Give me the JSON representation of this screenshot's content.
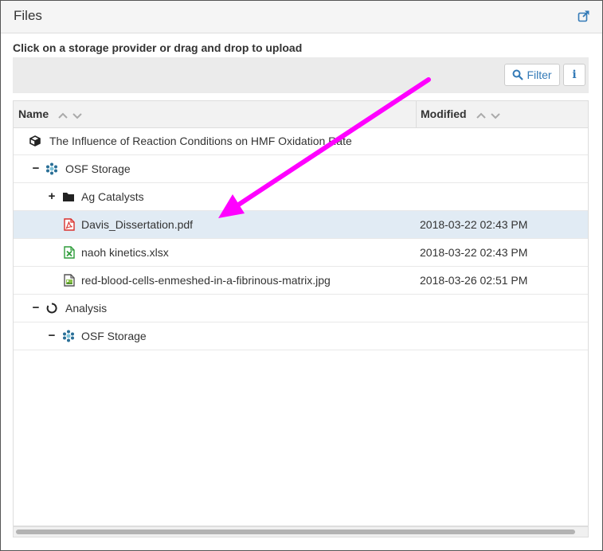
{
  "panel": {
    "title": "Files",
    "external_link_icon": "external-link-icon"
  },
  "instructions": "Click on a storage provider or drag and drop to upload",
  "toolbar": {
    "filter_label": "Filter",
    "filter_icon": "search-icon",
    "info_label": "i"
  },
  "columns": {
    "name": "Name",
    "modified": "Modified"
  },
  "rows": [
    {
      "label": "The Influence of Reaction Conditions on HMF Oxidation Rate",
      "modified": "",
      "icon": "cube-icon"
    },
    {
      "label": "OSF Storage",
      "modified": "",
      "icon": "osf-storage-icon",
      "toggle": "−"
    },
    {
      "label": "Ag Catalysts",
      "modified": "",
      "icon": "folder-icon",
      "toggle": "+"
    },
    {
      "label": "Davis_Dissertation.pdf",
      "modified": "2018-03-22 02:43 PM",
      "icon": "pdf-file-icon",
      "selected": true
    },
    {
      "label": "naoh kinetics.xlsx",
      "modified": "2018-03-22 02:43 PM",
      "icon": "excel-file-icon"
    },
    {
      "label": "red-blood-cells-enmeshed-in-a-fibrinous-matrix.jpg",
      "modified": "2018-03-26 02:51 PM",
      "icon": "image-file-icon"
    },
    {
      "label": "Analysis",
      "modified": "",
      "icon": "component-circle-icon",
      "toggle": "−"
    },
    {
      "label": "OSF Storage",
      "modified": "",
      "icon": "osf-storage-icon",
      "toggle": "−"
    }
  ],
  "colors": {
    "accent": "#337ab7",
    "selected_row": "#e1ebf4",
    "annotation_arrow": "#ff00ff",
    "pdf": "#d9302c",
    "excel": "#2e9c3a"
  }
}
